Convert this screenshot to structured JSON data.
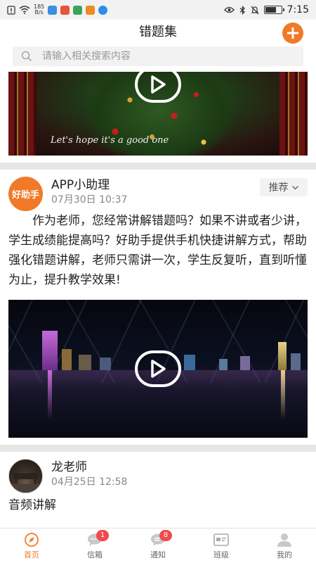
{
  "status_bar": {
    "net_speed_top": "185",
    "net_speed_bottom": "B/s",
    "battery_level": 0.7,
    "time": "7:15"
  },
  "header": {
    "title": "错题集",
    "add_icon": "plus-icon",
    "accent_color": "#f07a28"
  },
  "search": {
    "placeholder": "请输入相关搜索内容",
    "icon": "search-icon"
  },
  "feed": {
    "first_video_caption": "Let's hope it's a good one",
    "posts": [
      {
        "avatar_text": "好助手",
        "author": "APP小助理",
        "time": "07月30日 10:37",
        "tag": "推荐",
        "body": "作为老师，您经常讲解错题吗？如果不讲或者少讲，学生成绩能提高吗？好助手提供手机快捷讲解方式，帮助强化错题讲解，老师只需讲一次，学生反复听，直到听懂为止，提升教学效果!"
      },
      {
        "author": "龙老师",
        "time": "04月25日 12:58",
        "body": "音频讲解"
      }
    ]
  },
  "tab_bar": {
    "items": [
      {
        "label": "首页",
        "icon": "compass-icon",
        "active": true
      },
      {
        "label": "信箱",
        "icon": "chat-icon",
        "badge": "1"
      },
      {
        "label": "通知",
        "icon": "message-icon",
        "badge": "8"
      },
      {
        "label": "班级",
        "icon": "id-card-icon"
      },
      {
        "label": "我的",
        "icon": "person-icon"
      }
    ]
  }
}
